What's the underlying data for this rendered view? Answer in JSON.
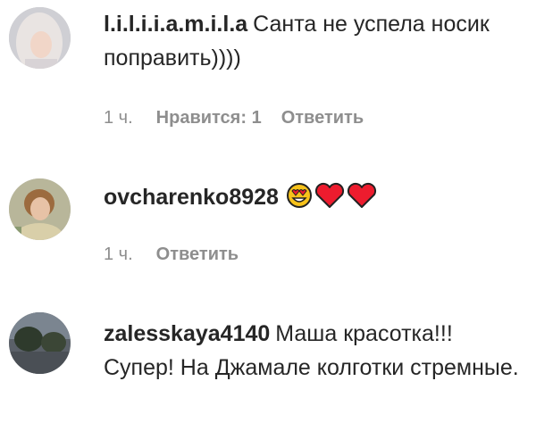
{
  "comments": [
    {
      "username": "l.i.l.i.i.a.m.i.l.a",
      "text": "Санта не успела носик поправить))))",
      "time": "1 ч.",
      "likes": "Нравится: 1",
      "reply": "Ответить"
    },
    {
      "username": "ovcharenko8928",
      "text": "",
      "emojis": [
        "heart-eyes-emoji",
        "red-heart-emoji",
        "red-heart-emoji"
      ],
      "time": "1 ч.",
      "reply": "Ответить"
    },
    {
      "username": "zalesskaya4140",
      "text": "Маша красотка!!! Супер! На Джамале колготки стремные."
    }
  ],
  "colors": {
    "text": "#262626",
    "meta": "#8e8e8e",
    "heart": "#ed1c2e",
    "emoji_face": "#f7c21b"
  }
}
